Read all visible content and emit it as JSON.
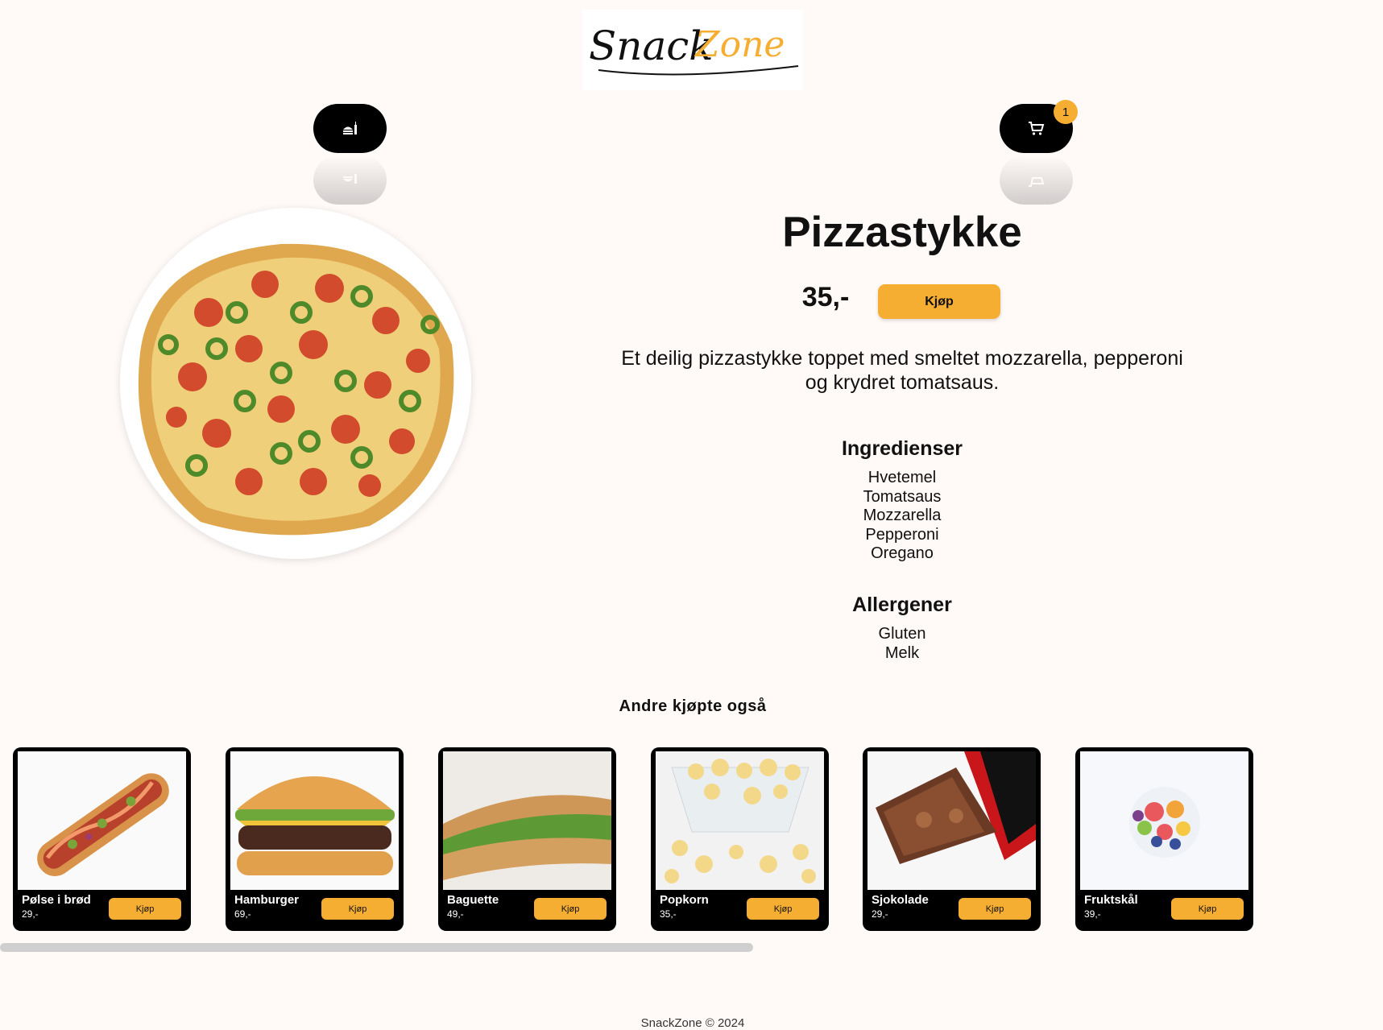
{
  "header": {
    "logo_text": "SnackZone",
    "menu_icon": "food-menu-icon",
    "cart_icon": "cart-icon",
    "cart_count": "1"
  },
  "product": {
    "title": "Pizzastykke",
    "price": "35,-",
    "buy_label": "Kjøp",
    "description": "Et deilig pizzastykke toppet med smeltet mozzarella, pepperoni og krydret tomatsaus.",
    "ingredients_title": "Ingredienser",
    "ingredients": [
      "Hvetemel",
      "Tomatsaus",
      "Mozzarella",
      "Pepperoni",
      "Oregano"
    ],
    "allergens_title": "Allergener",
    "allergens": [
      "Gluten",
      "Melk"
    ]
  },
  "also_bought": {
    "title": "Andre kjøpte også",
    "items": [
      {
        "name": "Pølse i brød",
        "price": "29,-",
        "buy_label": "Kjøp"
      },
      {
        "name": "Hamburger",
        "price": "69,-",
        "buy_label": "Kjøp"
      },
      {
        "name": "Baguette",
        "price": "49,-",
        "buy_label": "Kjøp"
      },
      {
        "name": "Popkorn",
        "price": "35,-",
        "buy_label": "Kjøp"
      },
      {
        "name": "Sjokolade",
        "price": "29,-",
        "buy_label": "Kjøp"
      },
      {
        "name": "Fruktskål",
        "price": "39,-",
        "buy_label": "Kjøp"
      }
    ]
  },
  "footer": {
    "text": "SnackZone © 2024"
  },
  "colors": {
    "accent": "#f5ae32",
    "background": "#fffaf8",
    "pill": "#000000"
  }
}
